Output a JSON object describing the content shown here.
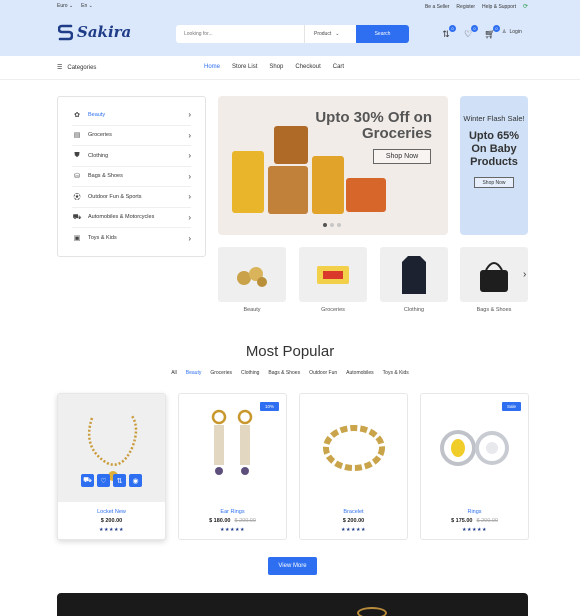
{
  "topbar": {
    "currency": "Euro",
    "language": "En",
    "links": [
      "Be a Seller",
      "Register",
      "Help & Support"
    ]
  },
  "brand": {
    "name": "Sakira",
    "color": "#1f3c88"
  },
  "search": {
    "placeholder": "Looking for...",
    "category": "Product",
    "button": "Search"
  },
  "header_icons": [
    {
      "icon": "compare-icon",
      "badge": "0"
    },
    {
      "icon": "heart-icon",
      "badge": "0"
    },
    {
      "icon": "cart-icon",
      "badge": "0"
    }
  ],
  "login": "Login",
  "nav": {
    "categories": "Categories",
    "menu": [
      "Home",
      "Store List",
      "Shop",
      "Checkout",
      "Cart"
    ],
    "active": "Home"
  },
  "sidebar": [
    {
      "label": "Beauty",
      "icon": "beauty-icon"
    },
    {
      "label": "Groceries",
      "icon": "groceries-icon"
    },
    {
      "label": "Clothing",
      "icon": "clothing-icon"
    },
    {
      "label": "Bags & Shoes",
      "icon": "bag-icon"
    },
    {
      "label": "Outdoor Fun & Sports",
      "icon": "sports-icon"
    },
    {
      "label": "Automobiles & Motorcycles",
      "icon": "car-icon"
    },
    {
      "label": "Toys & Kids",
      "icon": "toys-icon"
    }
  ],
  "hero": {
    "title": "Upto 30% Off on Groceries",
    "button": "Shop Now"
  },
  "flash": {
    "line1": "Winter Flash Sale!",
    "line2": "Upto 65% On Baby Products",
    "button": "Shop Now"
  },
  "category_cards": [
    {
      "label": "Beauty"
    },
    {
      "label": "Groceries"
    },
    {
      "label": "Clothing"
    },
    {
      "label": "Bags & Shoes"
    }
  ],
  "popular": {
    "title": "Most Popular",
    "tabs": [
      "All",
      "Beauty",
      "Groceries",
      "Clothing",
      "Bags & Shoes",
      "Outdoor Fun",
      "Automobiles",
      "Toys & Kids"
    ],
    "active_tab": "Beauty",
    "products": [
      {
        "name": "Locket New",
        "price": "$ 200.00",
        "old_price": "",
        "tag": "",
        "stars": "★★★★★"
      },
      {
        "name": "Ear Rings",
        "price": "$ 180.00",
        "old_price": "$ 200.00",
        "tag": "10%",
        "stars": "★★★★★"
      },
      {
        "name": "Bracelet",
        "price": "$ 200.00",
        "old_price": "",
        "tag": "",
        "stars": "★★★★★"
      },
      {
        "name": "Rings",
        "price": "$ 175.00",
        "old_price": "$ 200.00",
        "tag": "Sale",
        "stars": "★★★★★"
      }
    ],
    "view_more": "View More"
  },
  "colors": {
    "accent": "#2d6ff0",
    "header_bg": "#dbe8fb"
  }
}
